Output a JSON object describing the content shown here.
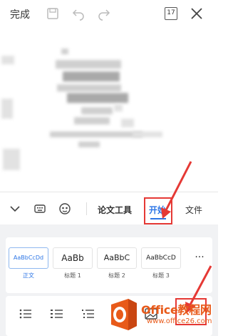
{
  "topbar": {
    "done_label": "完成",
    "page_count": "17",
    "icons": [
      "save-icon",
      "undo-icon",
      "redo-icon",
      "page-count-icon",
      "close-icon"
    ]
  },
  "tabs": {
    "icons": [
      "chevron-down-icon",
      "keyboard-icon",
      "ai-assistant-icon"
    ],
    "paper_tool": "论文工具",
    "start": "开始",
    "file": "文件"
  },
  "styles": {
    "items": [
      {
        "preview": "AaBbCcDd",
        "label": "正文",
        "selected": true
      },
      {
        "preview": "AaBb",
        "label": "标题 1"
      },
      {
        "preview": "AaBbC",
        "label": "标题 2"
      },
      {
        "preview": "AaBbCcD",
        "label": "标题 3"
      }
    ],
    "more_label": "···"
  },
  "format_icons": [
    "bullet-list-icon",
    "numbered-list-icon",
    "multilevel-list-icon",
    "indent-icon",
    "image-icon"
  ],
  "watermark": {
    "main": "Office教程网",
    "sub": "www.office26.com"
  },
  "colors": {
    "accent": "#2d76e6",
    "annotation": "#e53935",
    "watermark": "#e85a1a"
  }
}
